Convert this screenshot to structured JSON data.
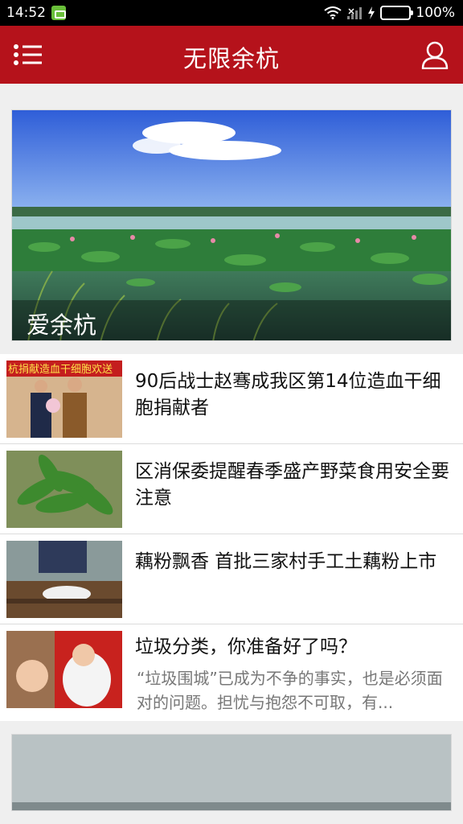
{
  "status_bar": {
    "time": "14:52",
    "battery": "100%"
  },
  "app_bar": {
    "title": "无限余杭",
    "menu_icon": "menu-icon",
    "user_icon": "user-icon"
  },
  "hero": {
    "caption": "爱余杭"
  },
  "news": [
    {
      "title": "90后战士赵骞成我区第14位造血干细胞捐献者",
      "thumb_text": "杭捐献造血干细胞欢送"
    },
    {
      "title": "区消保委提醒春季盛产野菜食用安全要注意"
    },
    {
      "title": "藕粉飘香 首批三家村手工土藕粉上市"
    },
    {
      "title": "垃圾分类，你准备好了吗？",
      "summary": "“垃圾围城”已成为不争的事实，也是必须面对的问题。担忧与抱怨不可取，有..."
    }
  ],
  "colors": {
    "brand": "#b5121b",
    "status_bar": "#000000",
    "battery": "#35c23a"
  }
}
